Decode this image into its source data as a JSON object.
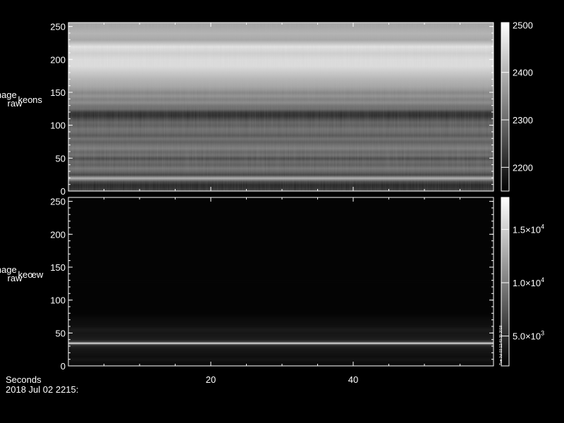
{
  "chart_data": [
    {
      "type": "heatmap",
      "ylabel_lines": [
        "image",
        "raw",
        "keo",
        "ns"
      ],
      "ylim": [
        0,
        256
      ],
      "yticks": [
        "0",
        "50",
        "100",
        "150",
        "200",
        "250"
      ],
      "colorbar": {
        "range": [
          2150,
          2505
        ],
        "ticks": [
          "2200",
          "2300",
          "2400",
          "2500"
        ]
      },
      "row_profile": {
        "y": [
          0,
          5,
          10,
          15,
          20,
          25,
          30,
          35,
          40,
          45,
          50,
          55,
          60,
          65,
          70,
          75,
          80,
          85,
          90,
          95,
          100,
          105,
          110,
          115,
          120,
          125,
          130,
          135,
          140,
          145,
          150,
          155,
          160,
          170,
          180,
          190,
          200,
          210,
          220,
          230,
          240,
          250,
          256
        ],
        "value": [
          2250,
          2200,
          2190,
          2240,
          2400,
          2230,
          2280,
          2310,
          2270,
          2290,
          2240,
          2300,
          2280,
          2320,
          2300,
          2270,
          2300,
          2260,
          2290,
          2300,
          2270,
          2280,
          2240,
          2200,
          2210,
          2290,
          2300,
          2340,
          2320,
          2350,
          2330,
          2360,
          2380,
          2400,
          2430,
          2460,
          2460,
          2440,
          2470,
          2380,
          2400,
          2380,
          2380
        ]
      }
    },
    {
      "type": "heatmap",
      "ylabel_lines": [
        "image",
        "raw",
        "keo",
        "ew"
      ],
      "xlabel": "Seconds",
      "xticks": [
        "20",
        "40"
      ],
      "ylim": [
        0,
        256
      ],
      "yticks": [
        "0",
        "50",
        "100",
        "150",
        "200",
        "250"
      ],
      "colorbar": {
        "range": [
          2200,
          18000
        ],
        "ticks": [
          {
            "mant": "5.0×10",
            "exp": "3"
          },
          {
            "mant": "1.0×10",
            "exp": "4"
          },
          {
            "mant": "1.5×10",
            "exp": "4"
          }
        ],
        "side_text": "Tue Jul 03 12:40:35 2018"
      },
      "row_profile": {
        "y": [
          0,
          5,
          10,
          15,
          20,
          25,
          30,
          33,
          35,
          37,
          40,
          45,
          50,
          55,
          60,
          65,
          70,
          75,
          80,
          256
        ],
        "value": [
          3200,
          2900,
          3500,
          3100,
          3400,
          3600,
          4200,
          6000,
          17000,
          6500,
          4200,
          3800,
          3600,
          3900,
          3300,
          3100,
          3000,
          2700,
          2500,
          2500
        ]
      }
    }
  ],
  "footer": {
    "date_label": "2018 Jul 02 2215:"
  }
}
